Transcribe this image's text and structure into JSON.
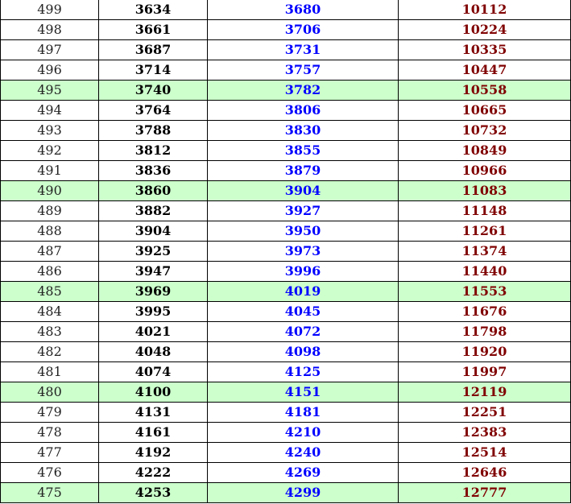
{
  "colors": {
    "col2": "#000000",
    "col3": "#0000ff",
    "col4": "#800000",
    "highlight_row": "#ccffcc"
  },
  "rows": [
    {
      "score": "499",
      "a": "3634",
      "b": "3680",
      "c": "10112",
      "highlight": false
    },
    {
      "score": "498",
      "a": "3661",
      "b": "3706",
      "c": "10224",
      "highlight": false
    },
    {
      "score": "497",
      "a": "3687",
      "b": "3731",
      "c": "10335",
      "highlight": false
    },
    {
      "score": "496",
      "a": "3714",
      "b": "3757",
      "c": "10447",
      "highlight": false
    },
    {
      "score": "495",
      "a": "3740",
      "b": "3782",
      "c": "10558",
      "highlight": true
    },
    {
      "score": "494",
      "a": "3764",
      "b": "3806",
      "c": "10665",
      "highlight": false
    },
    {
      "score": "493",
      "a": "3788",
      "b": "3830",
      "c": "10732",
      "highlight": false
    },
    {
      "score": "492",
      "a": "3812",
      "b": "3855",
      "c": "10849",
      "highlight": false
    },
    {
      "score": "491",
      "a": "3836",
      "b": "3879",
      "c": "10966",
      "highlight": false
    },
    {
      "score": "490",
      "a": "3860",
      "b": "3904",
      "c": "11083",
      "highlight": true
    },
    {
      "score": "489",
      "a": "3882",
      "b": "3927",
      "c": "11148",
      "highlight": false
    },
    {
      "score": "488",
      "a": "3904",
      "b": "3950",
      "c": "11261",
      "highlight": false
    },
    {
      "score": "487",
      "a": "3925",
      "b": "3973",
      "c": "11374",
      "highlight": false
    },
    {
      "score": "486",
      "a": "3947",
      "b": "3996",
      "c": "11440",
      "highlight": false
    },
    {
      "score": "485",
      "a": "3969",
      "b": "4019",
      "c": "11553",
      "highlight": true
    },
    {
      "score": "484",
      "a": "3995",
      "b": "4045",
      "c": "11676",
      "highlight": false
    },
    {
      "score": "483",
      "a": "4021",
      "b": "4072",
      "c": "11798",
      "highlight": false
    },
    {
      "score": "482",
      "a": "4048",
      "b": "4098",
      "c": "11920",
      "highlight": false
    },
    {
      "score": "481",
      "a": "4074",
      "b": "4125",
      "c": "11997",
      "highlight": false
    },
    {
      "score": "480",
      "a": "4100",
      "b": "4151",
      "c": "12119",
      "highlight": true
    },
    {
      "score": "479",
      "a": "4131",
      "b": "4181",
      "c": "12251",
      "highlight": false
    },
    {
      "score": "478",
      "a": "4161",
      "b": "4210",
      "c": "12383",
      "highlight": false
    },
    {
      "score": "477",
      "a": "4192",
      "b": "4240",
      "c": "12514",
      "highlight": false
    },
    {
      "score": "476",
      "a": "4222",
      "b": "4269",
      "c": "12646",
      "highlight": false
    },
    {
      "score": "475",
      "a": "4253",
      "b": "4299",
      "c": "12777",
      "highlight": true
    }
  ]
}
